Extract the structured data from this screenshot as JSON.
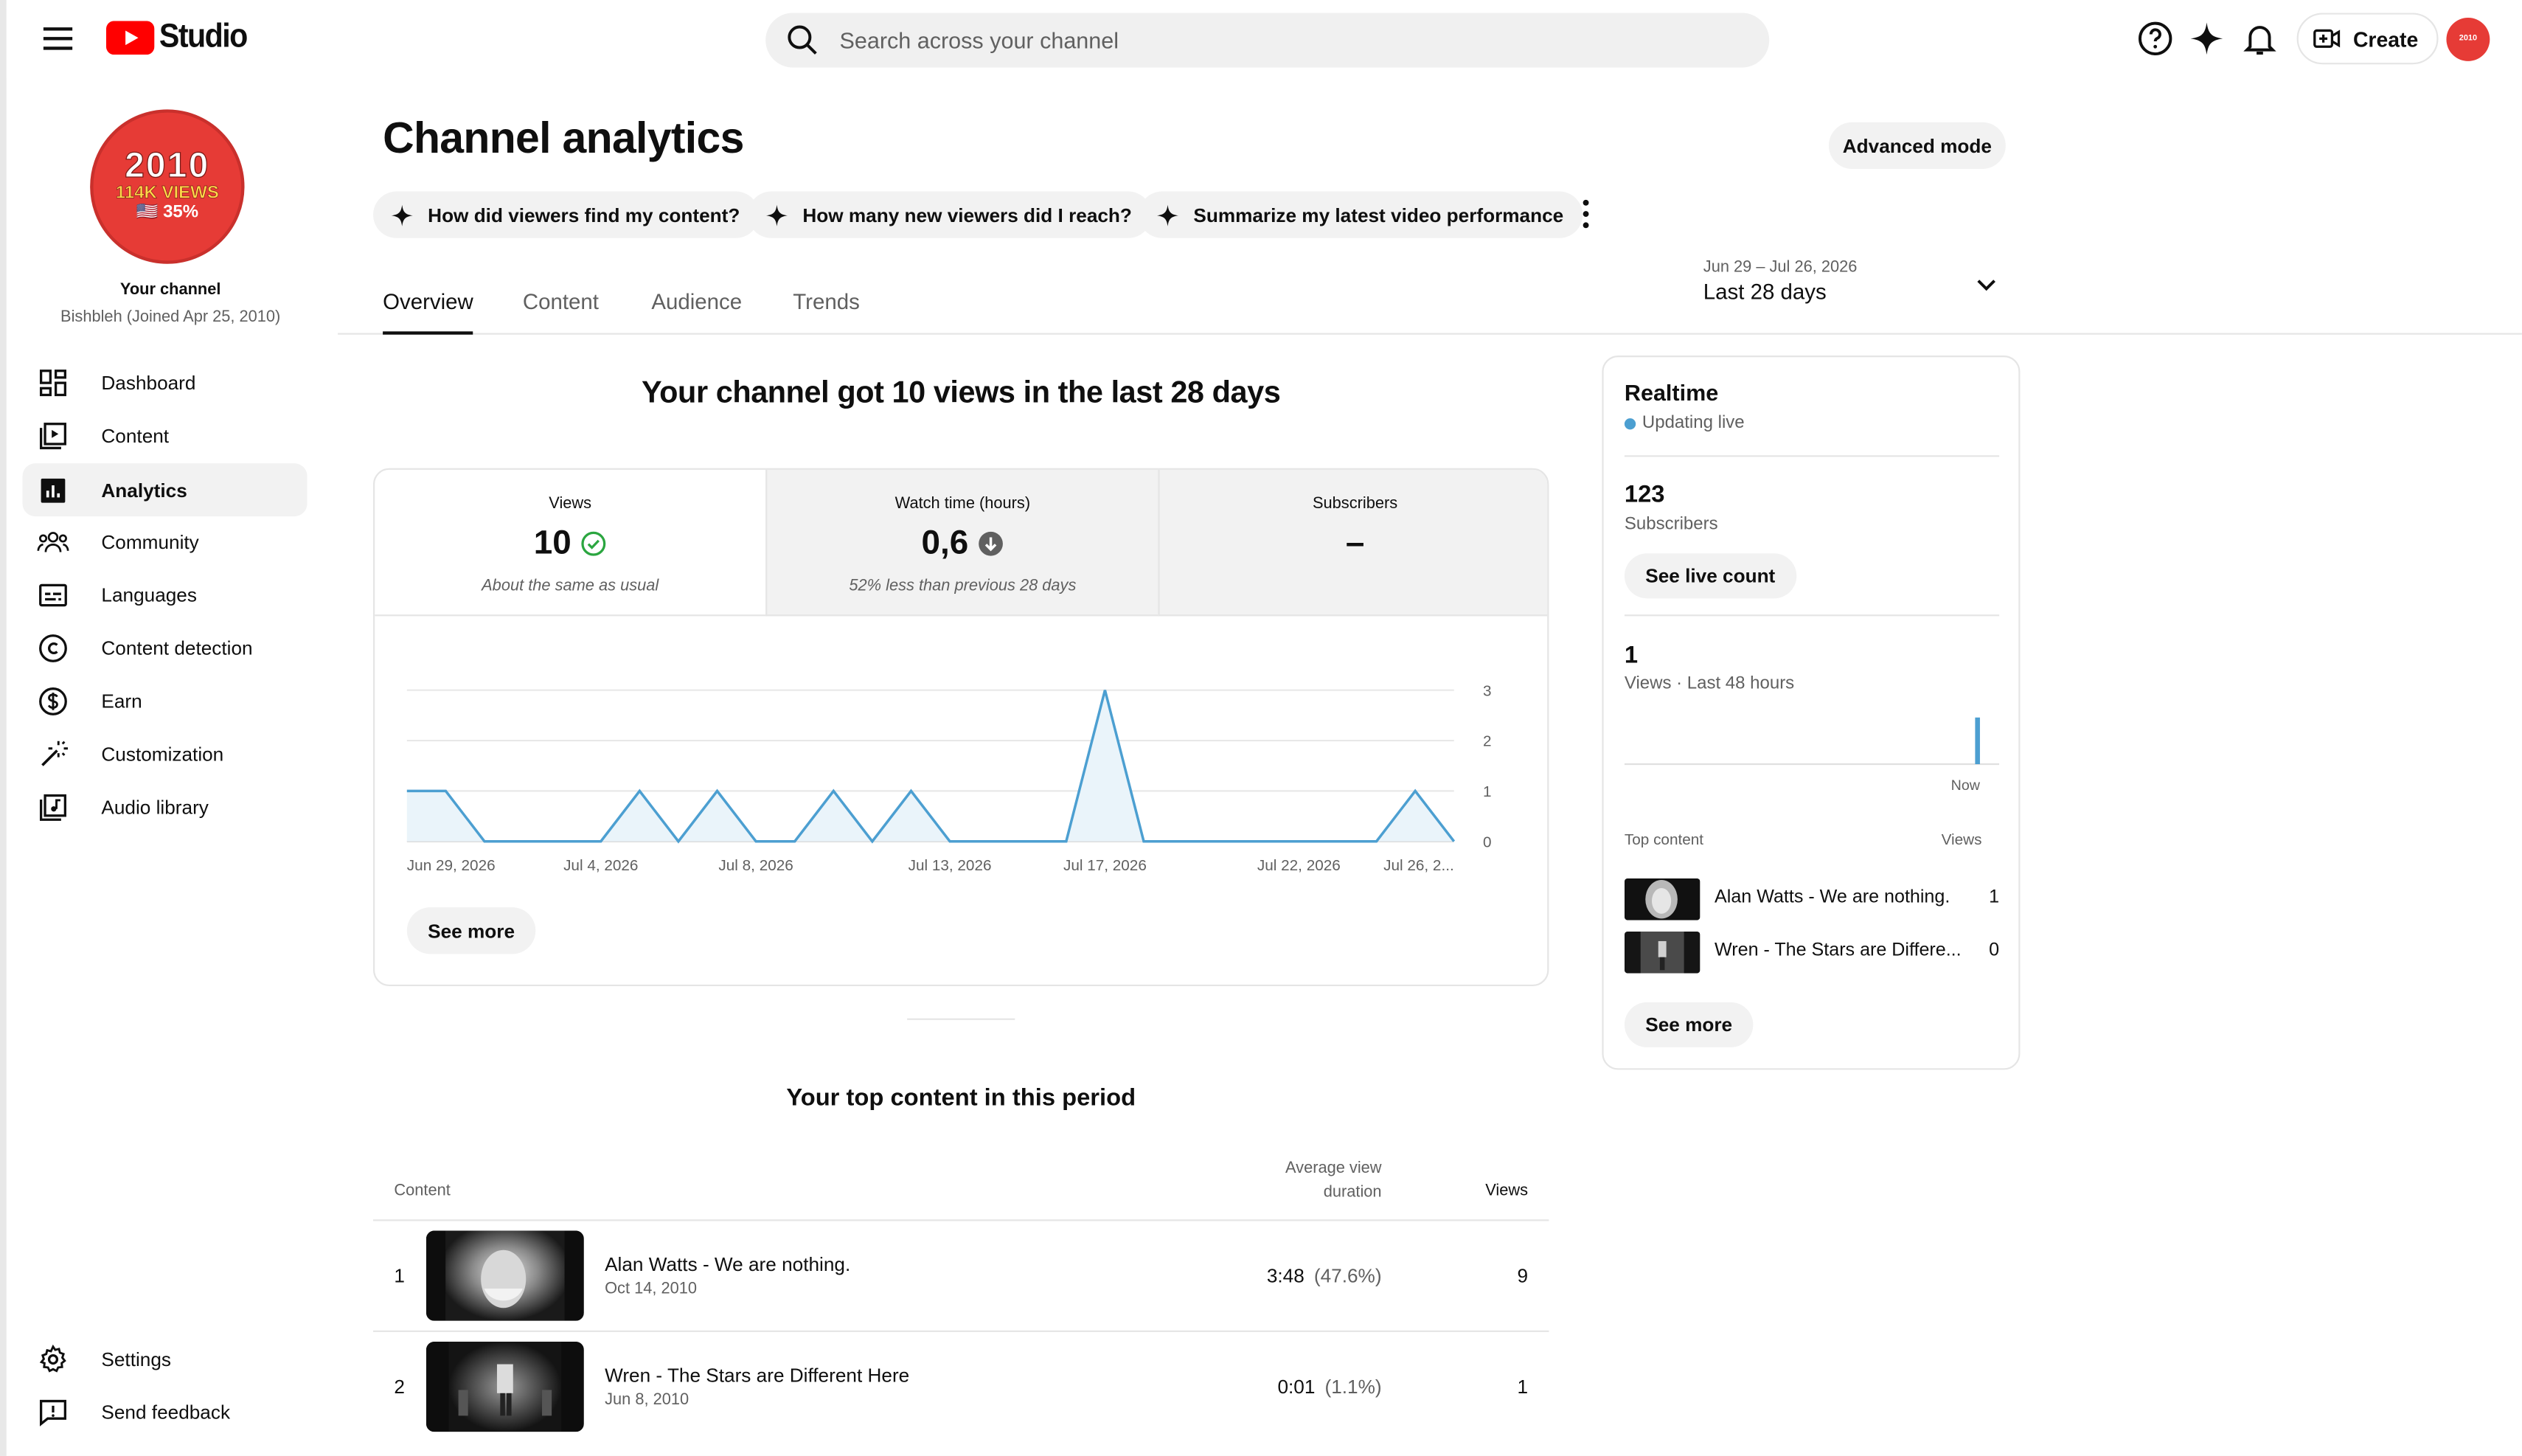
{
  "header": {
    "logo_text": "Studio",
    "search_placeholder": "Search across your channel",
    "create_label": "Create",
    "avatar_text": "2010"
  },
  "channel": {
    "avatar_year": "2010",
    "avatar_views": "114K VIEWS",
    "avatar_pct": "🇺🇸 35%",
    "label": "Your channel",
    "subtitle": "Bishbleh (Joined Apr 25, 2010)"
  },
  "sidebar": {
    "items": [
      {
        "label": "Dashboard",
        "icon": "dashboard-icon"
      },
      {
        "label": "Content",
        "icon": "content-icon"
      },
      {
        "label": "Analytics",
        "icon": "analytics-icon",
        "active": true
      },
      {
        "label": "Community",
        "icon": "community-icon"
      },
      {
        "label": "Languages",
        "icon": "languages-icon"
      },
      {
        "label": "Content detection",
        "icon": "copyright-icon"
      },
      {
        "label": "Earn",
        "icon": "dollar-icon"
      },
      {
        "label": "Customization",
        "icon": "magic-wand-icon"
      },
      {
        "label": "Audio library",
        "icon": "audio-library-icon"
      }
    ],
    "bottom": [
      {
        "label": "Settings",
        "icon": "gear-icon"
      },
      {
        "label": "Send feedback",
        "icon": "feedback-icon"
      }
    ]
  },
  "page": {
    "title": "Channel analytics",
    "advanced_mode": "Advanced mode",
    "chips": [
      "How did viewers find my content?",
      "How many new viewers did I reach?",
      "Summarize my latest video performance"
    ],
    "tabs": [
      "Overview",
      "Content",
      "Audience",
      "Trends"
    ],
    "active_tab": "Overview",
    "date_range_small": "Jun 29 – Jul 26, 2026",
    "date_range_label": "Last 28 days"
  },
  "overview": {
    "headline": "Your channel got 10 views in the last 28 days",
    "metrics": [
      {
        "label": "Views",
        "value": "10",
        "status": "check-circle-icon",
        "note": "About the same as usual"
      },
      {
        "label": "Watch time (hours)",
        "value": "0,6",
        "status": "arrow-down-circle-icon",
        "note": "52% less than previous 28 days"
      },
      {
        "label": "Subscribers",
        "value": "–",
        "note": ""
      }
    ],
    "see_more": "See more"
  },
  "chart_data": {
    "type": "area",
    "x": [
      "Jun 29",
      "Jun 30",
      "Jul 1",
      "Jul 2",
      "Jul 3",
      "Jul 4",
      "Jul 5",
      "Jul 6",
      "Jul 7",
      "Jul 8",
      "Jul 9",
      "Jul 10",
      "Jul 11",
      "Jul 12",
      "Jul 13",
      "Jul 14",
      "Jul 15",
      "Jul 16",
      "Jul 17",
      "Jul 18",
      "Jul 19",
      "Jul 20",
      "Jul 21",
      "Jul 22",
      "Jul 23",
      "Jul 24",
      "Jul 25",
      "Jul 26"
    ],
    "values": [
      1,
      1,
      0,
      0,
      0,
      0,
      1,
      0,
      1,
      0,
      0,
      1,
      0,
      1,
      0,
      0,
      0,
      0,
      3,
      0,
      0,
      0,
      0,
      0,
      0,
      0,
      1,
      0
    ],
    "x_tick_labels": [
      "Jun 29, 2026",
      "Jul 4, 2026",
      "Jul 8, 2026",
      "Jul 13, 2026",
      "Jul 17, 2026",
      "Jul 22, 2026",
      "Jul 26, 2..."
    ],
    "x_tick_index": [
      0,
      5,
      9,
      14,
      18,
      23,
      27
    ],
    "y_ticks": [
      "0",
      "1",
      "2",
      "3"
    ],
    "ylim": [
      0,
      3
    ],
    "color": "#4c9fd1",
    "fill": "#eaf4fa",
    "grid": true
  },
  "top_content": {
    "title": "Your top content in this period",
    "col_content": "Content",
    "col_avd": "Average view duration",
    "col_views": "Views",
    "rows": [
      {
        "rank": "1",
        "title": "Alan Watts - We are nothing.",
        "date": "Oct 14, 2010",
        "avd": "3:48",
        "avd_pct": "(47.6%)",
        "views": "9"
      },
      {
        "rank": "2",
        "title": "Wren - The Stars are Different Here",
        "date": "Jun 8, 2010",
        "avd": "0:01",
        "avd_pct": "(1.1%)",
        "views": "1"
      }
    ]
  },
  "realtime": {
    "title": "Realtime",
    "status": "Updating live",
    "subs_value": "123",
    "subs_label": "Subscribers",
    "see_live": "See live count",
    "views_value": "1",
    "views_label": "Views · Last 48 hours",
    "now_label": "Now",
    "top_content_label": "Top content",
    "views_col": "Views",
    "items": [
      {
        "title": "Alan Watts - We are nothing.",
        "views": "1"
      },
      {
        "title": "Wren - The Stars are Differe...",
        "views": "0"
      }
    ],
    "see_more": "See more",
    "accent": "#4c9fd1"
  }
}
